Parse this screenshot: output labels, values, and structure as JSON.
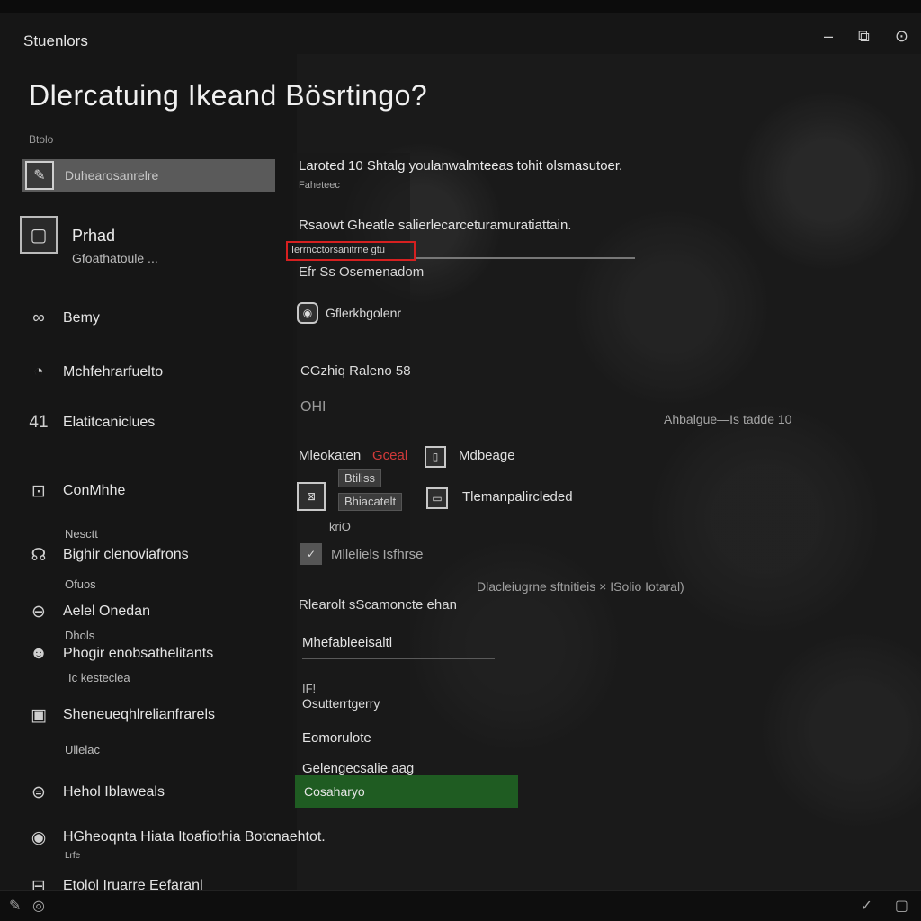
{
  "window": {
    "app_title": "Stuenlors",
    "controls": {
      "minimize": "–",
      "restore": "⧉",
      "close": "⊙"
    }
  },
  "page": {
    "title": "Dlercatuing Ikeand Bösrtingo?",
    "sidebar_label": "Btolo"
  },
  "sidebar": {
    "selected": {
      "label": "Duhearosanrelre"
    },
    "device": {
      "title": "Prhad",
      "subtitle": "Gfoathatoule ..."
    },
    "items": [
      {
        "icon": "∞",
        "label": "Bemy"
      },
      {
        "icon": "◔",
        "label": "Mchfehrarfuelto"
      },
      {
        "icon": "41",
        "label": "Elatitcaniclues"
      },
      {
        "icon": "⊡",
        "label": "ConMhhe"
      },
      {
        "icon": "☊",
        "label": "Bighir clenoviafrons"
      },
      {
        "icon": "⊖",
        "label": "Aelel Onedan"
      },
      {
        "icon": "☻",
        "label": "Phogir enobsathelitants"
      },
      {
        "icon": "▣",
        "label": "Sheneueqhlrelianfrarels"
      },
      {
        "icon": "⊜",
        "label": "Hehol Iblaweals"
      },
      {
        "icon": "◉",
        "label": "HGheoqnta Hiata Itoafiothia Botcnaehtot."
      },
      {
        "icon": "⊟",
        "label": "Etolol Iruarre Eefaranl"
      }
    ],
    "subs": [
      "Nesctt",
      "Ofuos",
      "Dhols",
      "Ic kesteclea",
      "Ullelac",
      "Lrfe"
    ]
  },
  "main": {
    "line1": "Laroted 10 Shtalg youlanwalmteeas tohit olsmasutoer.",
    "line1_sub": "Faheteec",
    "line2": "Rsaowt Gheatle salierlecarceturamuratiattain.",
    "highlight": "Ierrncctorsanitrne gtu",
    "line3": "Efr Ss Osemenadom",
    "toggle_label": "Gflerkbgolenr",
    "line4": "CGzhiq Raleno 58",
    "line5": "OHI",
    "right_note": "Ahbalgue—Is tadde 10",
    "row_a": "Mleokaten",
    "row_a_red": "Gceal",
    "row_b": "Mdbeage",
    "pill1": "Btiliss",
    "pill2": "Bhiacatelt",
    "row_c": "Tlemanpalircleded",
    "small1": "kriO",
    "row_d": "Mlleliels Isfhrse",
    "right_note2": "Dlacleiugrne sftnitieis × ISolio Iotaral)",
    "row_e": "Rlearolt sScamoncte ehan",
    "row_f": "Mhefableeisaltl",
    "small2": "IF!",
    "row_g": "Osutterrtgerry",
    "row_h": "Eomorulote",
    "row_i": "Gelengecsalie aag",
    "green_button": "Cosaharyo"
  }
}
